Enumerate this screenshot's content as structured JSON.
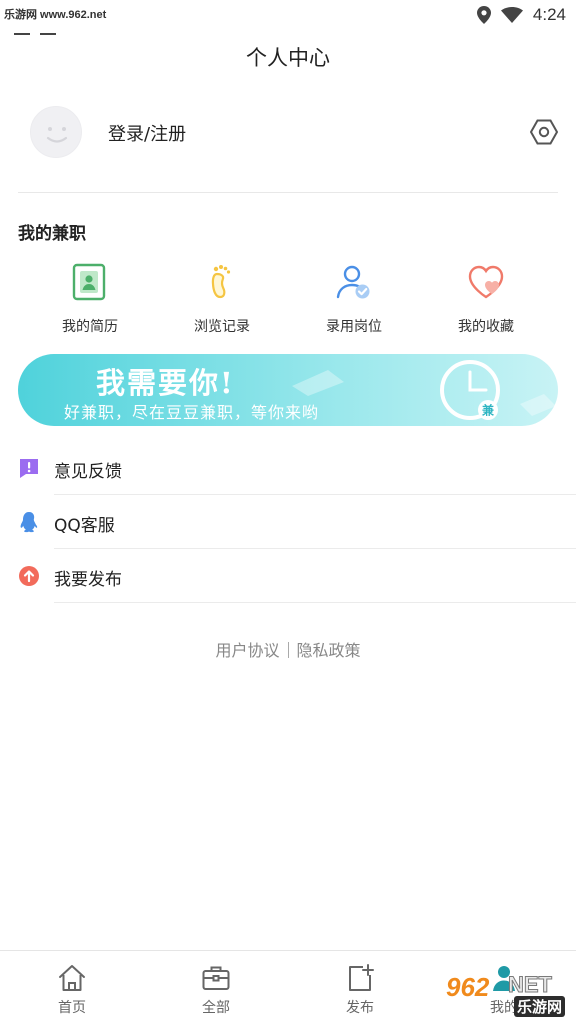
{
  "status_bar": {
    "watermark": "乐游网 www.962.net",
    "time": "4:24"
  },
  "header": {
    "title": "个人中心"
  },
  "profile": {
    "login_label": "登录/注册"
  },
  "part_time": {
    "title": "我的兼职",
    "items": [
      {
        "label": "我的简历",
        "icon": "resume-icon",
        "color": "#4caf6a"
      },
      {
        "label": "浏览记录",
        "icon": "footprint-icon",
        "color": "#f5c542"
      },
      {
        "label": "录用岗位",
        "icon": "hired-user-icon",
        "color": "#4a8fe6"
      },
      {
        "label": "我的收藏",
        "icon": "heart-icon",
        "color": "#f07a6a"
      }
    ]
  },
  "banner": {
    "title": "我需要你!",
    "subtitle": "好兼职，尽在豆豆兼职，等你来哟",
    "badge": "兼"
  },
  "menu": [
    {
      "label": "意见反馈",
      "icon": "feedback-icon",
      "color": "#9b6cf0"
    },
    {
      "label": "QQ客服",
      "icon": "qq-penguin-icon",
      "color": "#4a8fe6"
    },
    {
      "label": "我要发布",
      "icon": "upload-icon",
      "color": "#f26b5b"
    }
  ],
  "legal": {
    "user_agreement": "用户协议",
    "privacy_policy": "隐私政策"
  },
  "tabs": [
    {
      "label": "首页",
      "icon": "home-icon"
    },
    {
      "label": "全部",
      "icon": "briefcase-icon"
    },
    {
      "label": "发布",
      "icon": "publish-icon"
    },
    {
      "label": "我的",
      "icon": "profile-icon"
    }
  ],
  "watermark_bottom": {
    "number": "962",
    "net": "NET",
    "site": "乐游网"
  }
}
